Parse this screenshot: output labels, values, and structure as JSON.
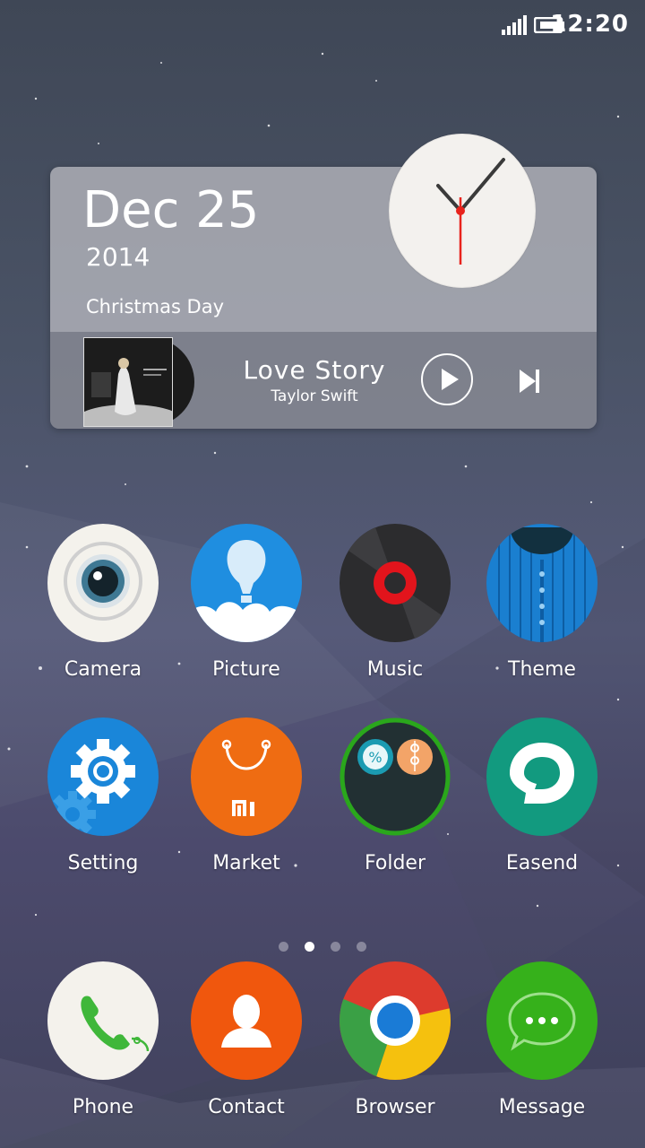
{
  "status_bar": {
    "time": "12:20"
  },
  "widget": {
    "date": "Dec 25",
    "year": "2014",
    "holiday": "Christmas Day",
    "music": {
      "title": "Love  Story",
      "artist": "Taylor  Swift"
    }
  },
  "apps": [
    {
      "label": "Camera"
    },
    {
      "label": "Picture"
    },
    {
      "label": "Music"
    },
    {
      "label": "Theme"
    },
    {
      "label": "Setting"
    },
    {
      "label": "Market"
    },
    {
      "label": "Folder"
    },
    {
      "label": "Easend"
    }
  ],
  "dock": [
    {
      "label": "Phone"
    },
    {
      "label": "Contact"
    },
    {
      "label": "Browser"
    },
    {
      "label": "Message"
    }
  ],
  "pager": {
    "pages": 4,
    "active_page": 2
  },
  "colors": {
    "clock_second_hand": "#e8231c",
    "setting": "#1a86d9",
    "market": "#ef6c12",
    "easend": "#129a7f",
    "message": "#36b11b",
    "contact": "#f0570d",
    "folder_ring": "#2aa71c"
  }
}
